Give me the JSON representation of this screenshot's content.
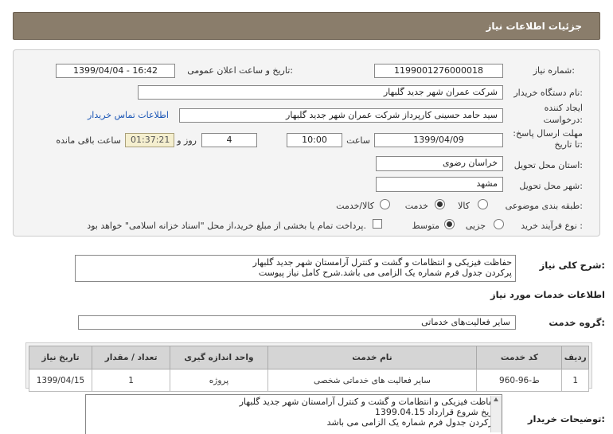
{
  "header": {
    "title": "جزئیات اطلاعات نیاز"
  },
  "form": {
    "need_number_label": "شماره نیاز:",
    "need_number": "1199001276000018",
    "announce_label": "تاریخ و ساعت اعلان عمومی:",
    "announce_value": "1399/04/04 - 16:42",
    "buyer_label": "نام دستگاه خریدار:",
    "buyer_value": "شرکت عمران شهر جدید گلبهار",
    "creator_label": "ایجاد کننده درخواست:",
    "creator_value": "سید حامد حسینی کارپرداز شرکت عمران شهر جدید گلبهار",
    "contact_link": "اطلاعات تماس خریدار",
    "deadline_label": "مهلت ارسال پاسخ: تا تاریخ:",
    "deadline_date": "1399/04/09",
    "time_label": "ساعت",
    "deadline_time": "10:00",
    "days_value": "4",
    "days_label": "روز و",
    "remaining_time": "01:37:21",
    "remaining_label": "ساعت باقی مانده",
    "province_label": "استان محل تحویل:",
    "province_value": "خراسان رضوی",
    "city_label": "شهر محل تحویل:",
    "city_value": "مشهد",
    "category_label": "طبقه بندی موضوعی:",
    "category_options": [
      "کالا",
      "خدمت",
      "کالا/خدمت"
    ],
    "category_selected": 1,
    "process_label": "نوع فرآیند خرید :",
    "process_options": [
      "جزیی",
      "متوسط"
    ],
    "process_selected": 1,
    "payment_note": "پرداخت تمام یا بخشی از مبلغ خرید،از محل \"اسناد خزانه اسلامی\" خواهد بود."
  },
  "summary": {
    "label": "شرح کلی نیاز:",
    "lines": [
      "حفاظت فیزیکی و انتظامات و گشت و کنترل آرامستان شهر جدید گلبهار",
      "پرکردن جدول فرم شماره یک الزامی می باشد.شرح کامل نیاز پیوست"
    ]
  },
  "services": {
    "section_title": "اطلاعات خدمات مورد نیاز",
    "group_label": "گروه خدمت:",
    "group_value": "سایر فعالیت‌های خدماتی",
    "columns": [
      "ردیف",
      "کد خدمت",
      "نام خدمت",
      "واحد اندازه گیری",
      "تعداد / مقدار",
      "تاریخ نیاز"
    ],
    "rows": [
      [
        "1",
        "ط-96-960",
        "سایر فعالیت های خدماتی شخصی",
        "پروژه",
        "1",
        "1399/04/15"
      ]
    ]
  },
  "buyer_notes": {
    "label": "توضیحات خریدار:",
    "lines": [
      "حفاظت فیزیکی و انتظامات و گشت و کنترل آرامستان شهر جدید گلبهار",
      "تاریخ شروع قرارداد 1399.04.15",
      "پرکردن جدول فرم شماره یک الزامی می باشد."
    ]
  }
}
